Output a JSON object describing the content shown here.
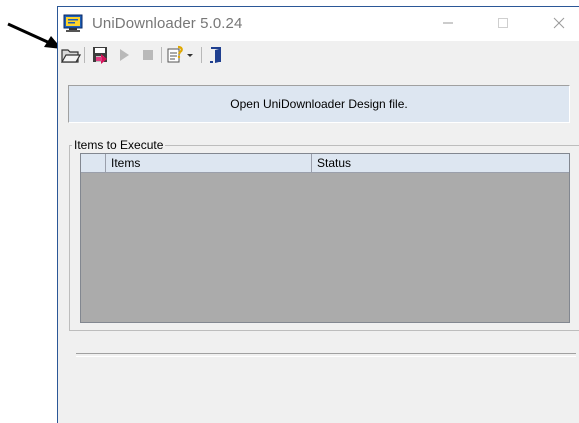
{
  "window": {
    "title": "UniDownloader 5.0.24",
    "accent_color": "#2b5797"
  },
  "toolbar": {
    "buttons": [
      {
        "name": "open-design-file",
        "icon": "open-folder-icon"
      },
      {
        "name": "save",
        "icon": "save-disk-icon"
      },
      {
        "name": "run",
        "icon": "play-icon"
      },
      {
        "name": "stop",
        "icon": "stop-icon"
      },
      {
        "name": "options",
        "icon": "settings-wizard-icon",
        "has_dropdown": true
      },
      {
        "name": "exit",
        "icon": "exit-door-icon"
      }
    ]
  },
  "banner": {
    "text": "Open UniDownloader Design file."
  },
  "items_group": {
    "label": "Items to Execute",
    "columns": [
      "",
      "Items",
      "Status"
    ],
    "rows": []
  },
  "annotation": {
    "arrow_target": "open-design-file",
    "arrow_color": "#000000"
  }
}
